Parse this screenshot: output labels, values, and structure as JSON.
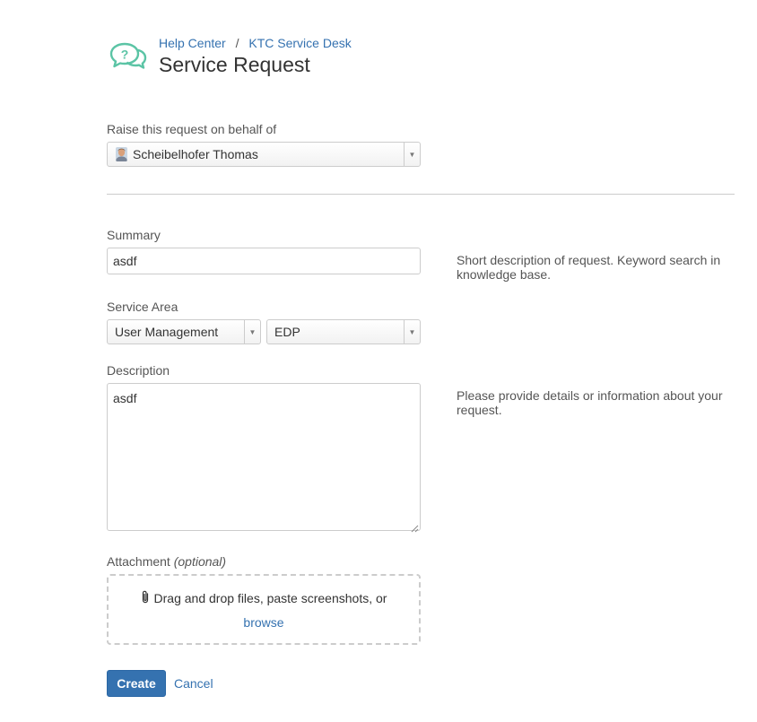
{
  "header": {
    "breadcrumb": [
      "Help Center",
      "KTC Service Desk"
    ],
    "breadcrumb_separator": "/",
    "title": "Service Request",
    "logo_icon": "speech-bubbles-question-icon",
    "logo_color": "#5bc4a5"
  },
  "on_behalf": {
    "label": "Raise this request on behalf of",
    "value": "Scheibelhofer Thomas",
    "avatar_icon": "user-avatar-icon"
  },
  "summary": {
    "label": "Summary",
    "value": "asdf",
    "help": "Short description of request. Keyword search in knowledge base."
  },
  "service_area": {
    "label": "Service Area",
    "primary_value": "User Management",
    "secondary_value": "EDP"
  },
  "description": {
    "label": "Description",
    "value": "asdf",
    "help": "Please provide details or information about your request."
  },
  "attachment": {
    "label": "Attachment",
    "optional": "(optional)",
    "drop_text": "Drag and drop files, paste screenshots, or",
    "browse_label": "browse",
    "icon": "paperclip-icon"
  },
  "actions": {
    "create_label": "Create",
    "cancel_label": "Cancel"
  },
  "colors": {
    "link": "#3572b0",
    "primary_button": "#3572b0",
    "border": "#cccccc"
  }
}
